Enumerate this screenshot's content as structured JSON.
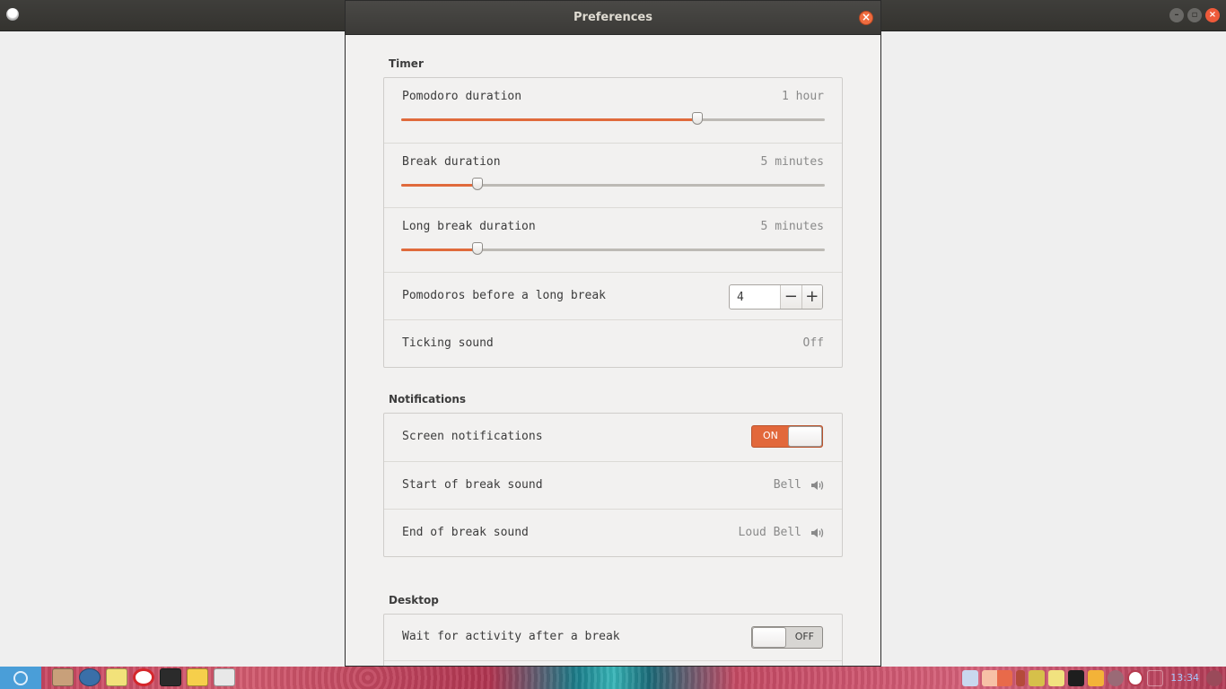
{
  "window": {
    "title": "Preferences",
    "close_glyph": "×",
    "bg_minimize_glyph": "–",
    "bg_maximize_glyph": "▫",
    "bg_close_glyph": "×"
  },
  "timer": {
    "section_title": "Timer",
    "pomodoro": {
      "label": "Pomodoro duration",
      "value": "1 hour",
      "level": 0.7
    },
    "break": {
      "label": "Break duration",
      "value": "5 minutes",
      "level": 0.18
    },
    "long_break": {
      "label": "Long break duration",
      "value": "5 minutes",
      "level": 0.18
    },
    "pomodoros_before_long_break": {
      "label": "Pomodoros before a long break",
      "value": "4",
      "minus": "−",
      "plus": "+"
    },
    "ticking_sound": {
      "label": "Ticking sound",
      "value": "Off"
    }
  },
  "notifications": {
    "section_title": "Notifications",
    "screen_notifications": {
      "label": "Screen notifications",
      "state": "ON"
    },
    "start_of_break_sound": {
      "label": "Start of break sound",
      "value": "Bell"
    },
    "end_of_break_sound": {
      "label": "End of break sound",
      "value": "Loud Bell"
    }
  },
  "desktop": {
    "section_title": "Desktop",
    "wait_for_activity": {
      "label": "Wait for activity after a break",
      "state": "OFF"
    }
  },
  "taskbar": {
    "clock": "13:34"
  },
  "colors": {
    "accent": "#e06a3c",
    "titlebar": "#3b3a37"
  }
}
